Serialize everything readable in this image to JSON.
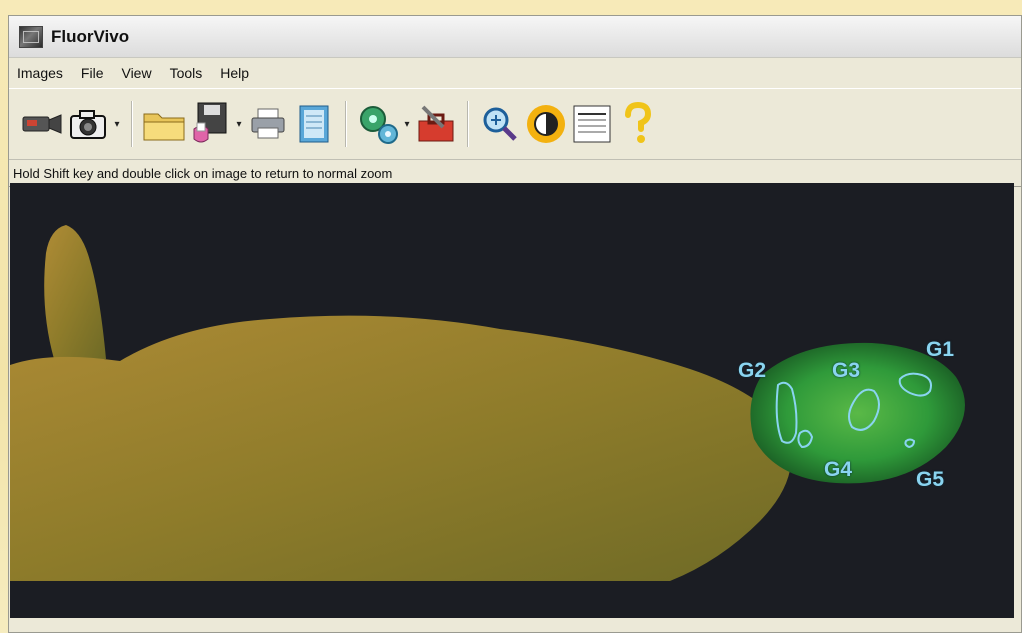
{
  "window": {
    "title": "FluorVivo"
  },
  "menu": [
    "Images",
    "File",
    "View",
    "Tools",
    "Help"
  ],
  "toolbar": {
    "buttons": [
      {
        "name": "video-camera-icon"
      },
      {
        "name": "camera-icon"
      },
      {
        "name": "open-folder-icon"
      },
      {
        "name": "save-disk-icon"
      },
      {
        "name": "print-icon"
      },
      {
        "name": "notepad-icon"
      },
      {
        "name": "gears-icon"
      },
      {
        "name": "toolbox-icon"
      },
      {
        "name": "zoom-icon"
      },
      {
        "name": "brightness-icon"
      },
      {
        "name": "report-icon"
      },
      {
        "name": "help-icon"
      }
    ]
  },
  "status": {
    "hint": "Hold Shift key and double click on image to return to normal zoom"
  },
  "image": {
    "roi_labels": [
      "G1",
      "G2",
      "G3",
      "G4",
      "G5"
    ],
    "colors": {
      "background": "#1b1d23",
      "tissue": "#a58a33",
      "fluorescence": "#2fb43c",
      "roi": "#8ad4f0"
    }
  }
}
